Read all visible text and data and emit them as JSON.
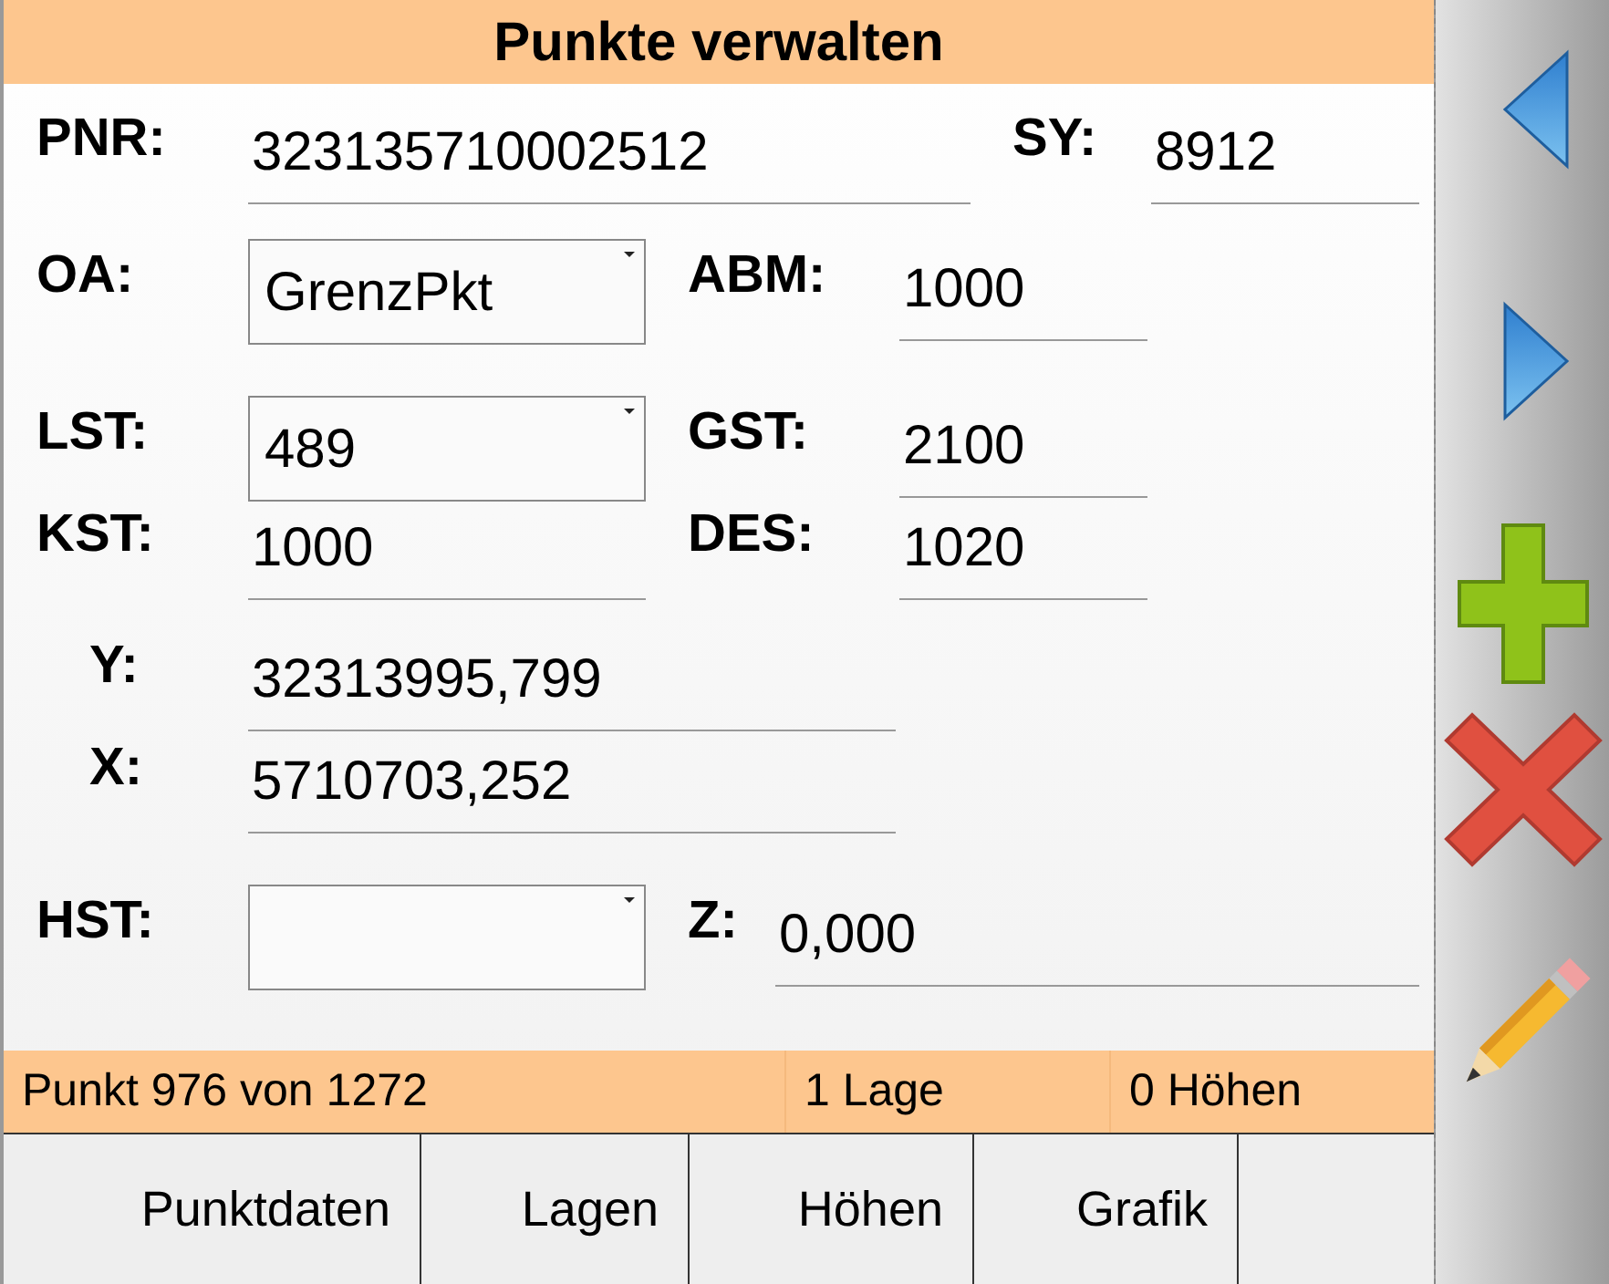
{
  "title": "Punkte verwalten",
  "rows": [
    {
      "fields": [
        {
          "label": "PNR:",
          "kind": "text",
          "value": "323135710002512"
        },
        {
          "label": "SY:",
          "kind": "text",
          "value": "8912"
        }
      ]
    },
    {
      "fields": [
        {
          "label": "OA:",
          "kind": "combo",
          "value": "GrenzPkt"
        },
        {
          "label": "ABM:",
          "kind": "text",
          "value": "1000"
        }
      ]
    },
    {
      "fields": [
        {
          "label": "LST:",
          "kind": "combo",
          "value": "489"
        },
        {
          "label": "GST:",
          "kind": "text",
          "value": "2100"
        }
      ]
    },
    {
      "fields": [
        {
          "label": "KST:",
          "kind": "text",
          "value": "1000"
        },
        {
          "label": "DES:",
          "kind": "text",
          "value": "1020"
        }
      ]
    },
    {
      "fields": [
        {
          "label": "Y:",
          "kind": "text",
          "value": "32313995,799"
        }
      ]
    },
    {
      "fields": [
        {
          "label": "X:",
          "kind": "text",
          "value": "5710703,252"
        }
      ]
    },
    {
      "fields": [
        {
          "label": "HST:",
          "kind": "combo"
        },
        {
          "label": "Z:",
          "kind": "text",
          "value": "0,000"
        }
      ]
    }
  ],
  "status_bar": [
    "Punkt 976 von 1272",
    "1 Lage",
    "0 Höhen"
  ],
  "tabs": [
    "Punktdaten",
    "Lagen",
    "Höhen",
    "Grafik"
  ]
}
